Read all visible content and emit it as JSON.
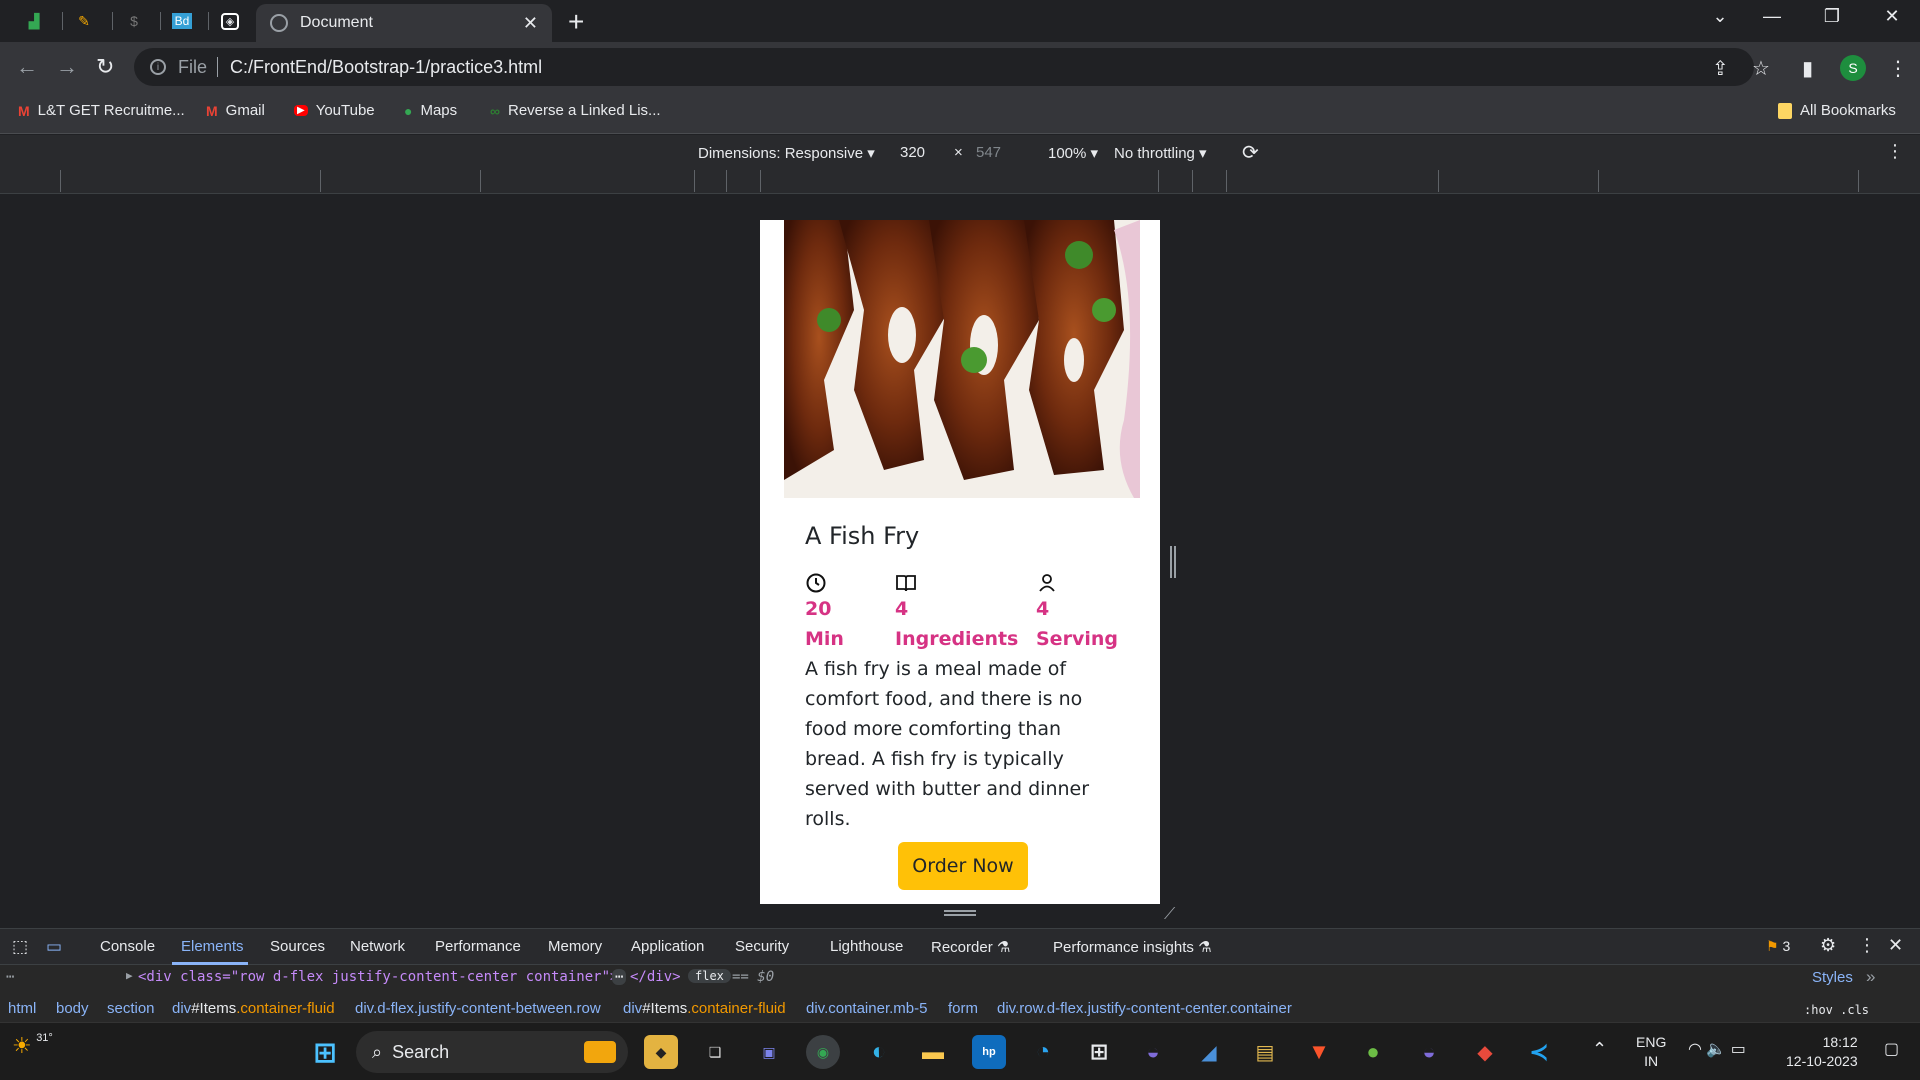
{
  "browser": {
    "tab_title": "Document",
    "tab_close": "✕",
    "new_tab": "+",
    "url_scheme": "File",
    "url": "C:/FrontEnd/Bootstrap-1/practice3.html",
    "profile_initial": "S",
    "bookmarks": [
      {
        "label": "L&T GET Recruitme...",
        "icon": "gmail-icon",
        "glyph": "M"
      },
      {
        "label": "Gmail",
        "icon": "gmail-icon",
        "glyph": "M"
      },
      {
        "label": "YouTube",
        "icon": "youtube-icon",
        "glyph": "▶"
      },
      {
        "label": "Maps",
        "icon": "maps-icon",
        "glyph": "●"
      },
      {
        "label": "Reverse a Linked Lis...",
        "icon": "link-icon",
        "glyph": "∞"
      }
    ],
    "all_bookmarks": "All Bookmarks"
  },
  "device_toolbar": {
    "dimensions": "Dimensions: Responsive",
    "width": "320",
    "times": "×",
    "height": "547",
    "zoom": "100%",
    "throttling": "No throttling"
  },
  "page": {
    "title": "A Fish Fry",
    "stats": [
      {
        "icon": "clock-history-icon",
        "glyph": "⟲",
        "value_line1": "20",
        "value_line2": "Min"
      },
      {
        "icon": "book-icon",
        "glyph": "📖",
        "value_line1": "4",
        "value_line2": "Ingredients"
      },
      {
        "icon": "person-icon",
        "glyph": "👤",
        "value_line1": "4",
        "value_line2": "Serving"
      }
    ],
    "description": "A fish fry is a meal made of comfort food, and there is no food more comforting than bread. A fish fry is typically served with butter and dinner rolls.",
    "button_label": "Order Now",
    "accent_color": "#d63384",
    "button_color": "#ffc107"
  },
  "devtools": {
    "tabs": [
      "Console",
      "Elements",
      "Sources",
      "Network",
      "Performance",
      "Memory",
      "Application",
      "Security",
      "Lighthouse",
      "Recorder",
      "Performance insights"
    ],
    "active_tab": "Elements",
    "issues_count": "3",
    "code_line": "<div class=\"row d-flex justify-content-center container\">",
    "code_ellipsis": "⋯",
    "code_close": "</div>",
    "code_badge": "flex",
    "code_eq": "== $0",
    "styles_tab": "Styles",
    "styles_filter": ":hov .cls",
    "breadcrumbs": [
      {
        "tag": "html",
        "rest": ""
      },
      {
        "tag": "body",
        "rest": ""
      },
      {
        "tag": "section",
        "rest": ""
      },
      {
        "tag": "div",
        "rest": "#Items",
        "cls": ".container-fluid"
      },
      {
        "tag": "div",
        "rest": "",
        "cls": ".d-flex.justify-content-between.row"
      },
      {
        "tag": "div",
        "rest": "#Items",
        "cls": ".container-fluid"
      },
      {
        "tag": "div",
        "rest": "",
        "cls": ".container.mb-5"
      },
      {
        "tag": "form",
        "rest": ""
      },
      {
        "tag": "div",
        "rest": "",
        "cls": ".row.d-flex.justify-content-center.container"
      }
    ]
  },
  "taskbar": {
    "weather": "31°",
    "search": "Search",
    "lang_line1": "ENG",
    "lang_line2": "IN",
    "time": "18:12",
    "date": "12-10-2023"
  }
}
